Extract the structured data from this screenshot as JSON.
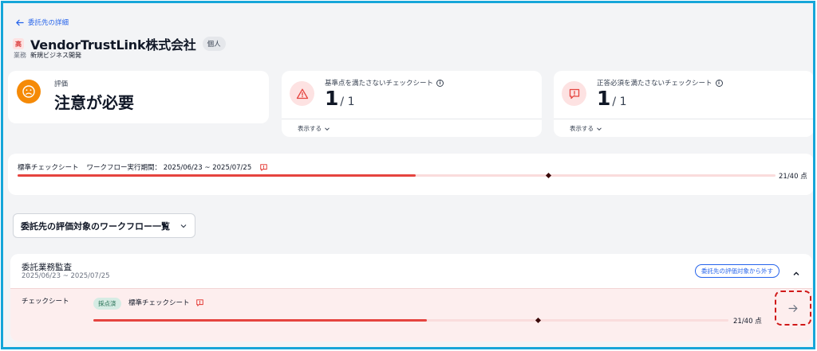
{
  "nav": {
    "back_label": "委託先の詳細"
  },
  "vendor": {
    "risk_badge": "高",
    "name": "VendorTrustLink株式会社",
    "type_chip": "個人",
    "dept_label": "業務",
    "dept_value": "新規ビジネス開発"
  },
  "evaluation": {
    "label": "評価",
    "value": "注意が必要"
  },
  "metrics": [
    {
      "label": "基準点を満たさないチェックシート",
      "value": "1",
      "total": "/ 1",
      "toggle": "表示する"
    },
    {
      "label": "正答必須を満たさないチェックシート",
      "value": "1",
      "total": "/ 1",
      "toggle": "表示する"
    }
  ],
  "sheet_summary": {
    "name": "標準チェックシート",
    "period": "ワークフロー実行期間： 2025/06/23 ~ 2025/07/25",
    "score_text": "21/40 点",
    "score": 21,
    "max_score": 40,
    "threshold": 28
  },
  "workflow_list": {
    "dropdown_label": "委託先の評価対象のワークフロー一覧"
  },
  "workflow": {
    "name": "委託業務監査",
    "period": "2025/06/23 ~ 2025/07/25",
    "remove_label": "委託先の評価対象から外す",
    "row_label": "チェックシート",
    "status_chip": "採点済",
    "sheet_name": "標準チェックシート",
    "score_text": "21/40 点",
    "score": 21,
    "max_score": 40,
    "threshold": 28
  },
  "colors": {
    "accent": "#2563eb",
    "warning": "#f58a07",
    "danger": "#e5443f",
    "danger_light": "#fde2e2",
    "success_chip": "#d6ece4"
  }
}
